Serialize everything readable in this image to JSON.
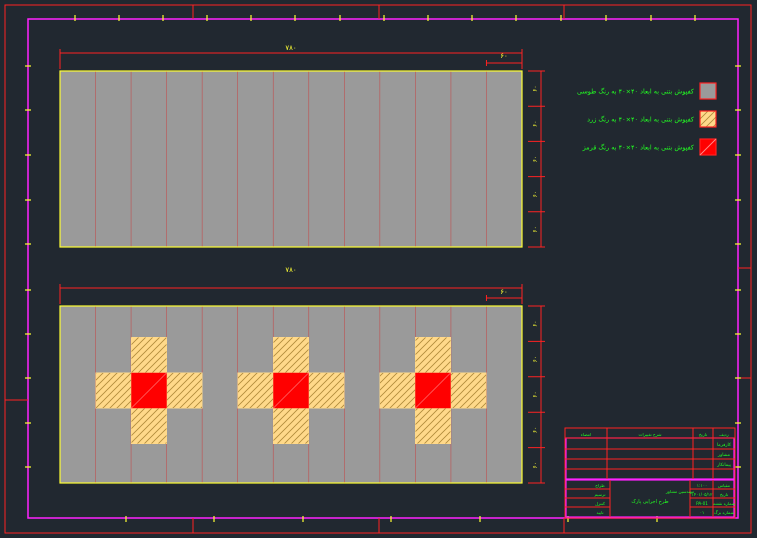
{
  "colors": {
    "background": "#212830",
    "outer_border": "#ff2222",
    "frame_border": "#ff22ff",
    "plan_outline": "#ffff33",
    "floor_fill": "#9a9a9a",
    "grid_line": "#c05050",
    "dimension_line": "#ff2222",
    "dimension_text": "#ffff33",
    "tile_gray": "#9a9a9a",
    "tile_yellow": "#ffd98a",
    "tile_red": "#ff0000",
    "hatch": "#b08a3a",
    "legend_text": "#22ff22",
    "title_block_line": "#ff2222",
    "title_block_frame": "#ff22ff",
    "title_block_text": "#22ff22"
  },
  "plan_top": {
    "overall_dimension": "۷۸۰",
    "module_dimension": "۶۰",
    "side_dimensions": [
      "۶۰",
      "۶۰",
      "۶۰",
      "۶۰",
      "۶۰"
    ],
    "grid_divisions": 13,
    "pattern": []
  },
  "plan_bottom": {
    "overall_dimension": "۷۸۰",
    "module_dimension": "۶۰",
    "side_dimensions": [
      "۶۰",
      "۶۰",
      "۶۰",
      "۶۰",
      "۶۰"
    ],
    "grid_divisions": 13,
    "pattern": [
      "cross",
      "cross",
      "cross"
    ]
  },
  "legend": {
    "items": [
      {
        "label": "کفپوش بتنی به ابعاد ۴۰×۴۰ به رنگ طوسی",
        "swatch": "gray"
      },
      {
        "label": "کفپوش بتنی به ابعاد ۴۰×۴۰ به رنگ زرد",
        "swatch": "yellow"
      },
      {
        "label": "کفپوش بتنی به ابعاد ۴۰×۴۰ به رنگ قرمز",
        "swatch": "red"
      }
    ]
  },
  "title_block": {
    "header_cells": [
      "امضاء",
      "شرح تغییرات",
      "تاریخ",
      "ردیف"
    ],
    "side_labels": [
      "کارفرما",
      "مشاور",
      "پیمانکار"
    ],
    "row_labels": [
      "طراح",
      "ترسیم",
      "کنترل",
      "تایید"
    ],
    "project_title": "طرح اجرایی پارک",
    "info_labels": [
      "مقیاس",
      "تاریخ",
      "شماره نقشه",
      "شماره برگ"
    ],
    "info_values": [
      "۱:۱۰۰",
      "۱۴۰۱/۰۵/۱۲",
      "PA-01",
      "۰۱"
    ],
    "company": "مهندسین مشاور"
  }
}
